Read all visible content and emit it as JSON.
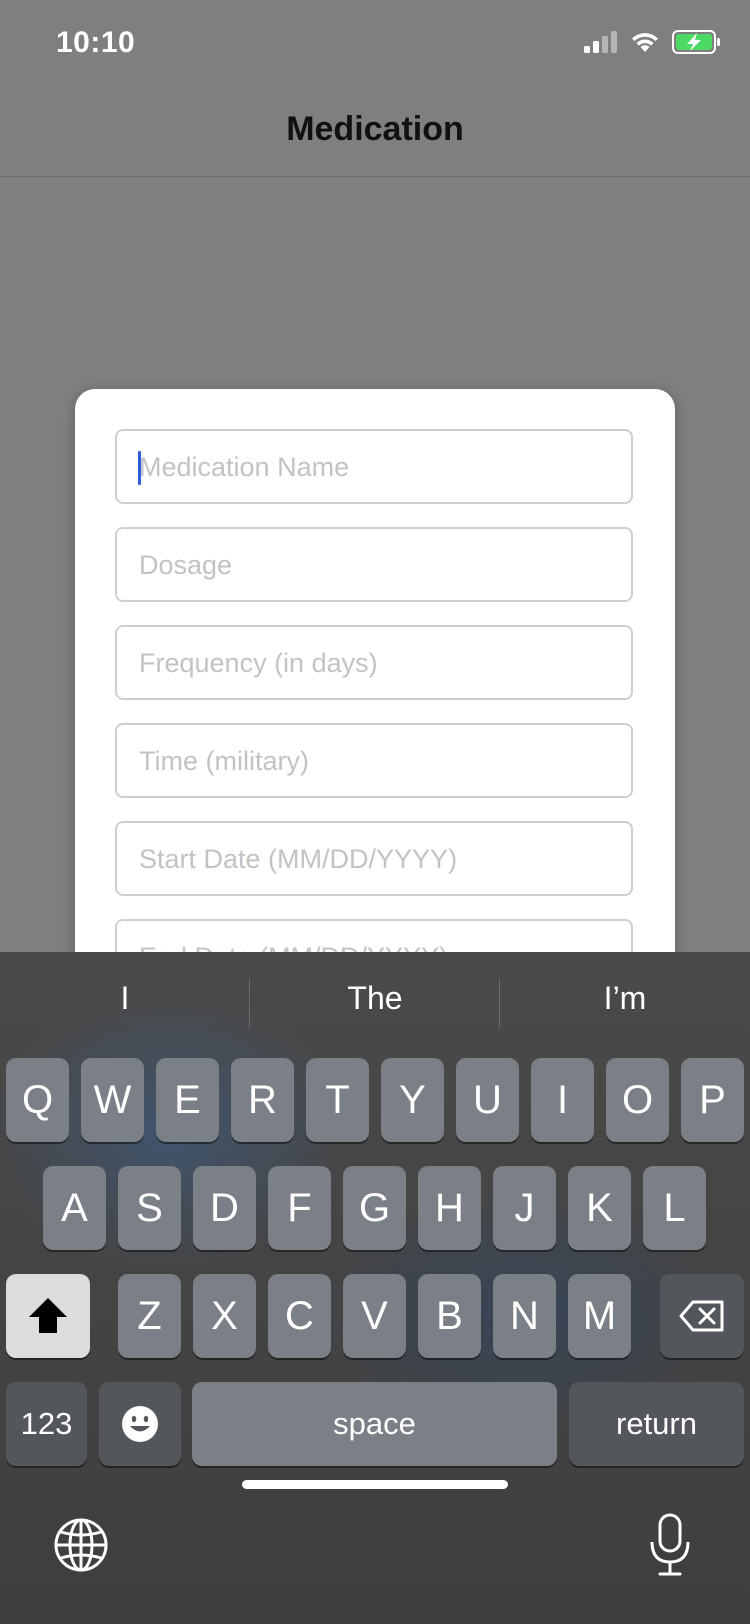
{
  "status_bar": {
    "time": "10:10"
  },
  "nav": {
    "title": "Medication"
  },
  "form": {
    "medication_name_placeholder": "Medication Name",
    "dosage_placeholder": "Dosage",
    "frequency_placeholder": "Frequency (in days)",
    "time_placeholder": "Time (military)",
    "start_date_placeholder": "Start Date (MM/DD/YYYY)",
    "end_date_placeholder": "End Date (MM/DD/YYYY)"
  },
  "keyboard": {
    "suggestions": [
      "I",
      "The",
      "I’m"
    ],
    "row1": [
      "Q",
      "W",
      "E",
      "R",
      "T",
      "Y",
      "U",
      "I",
      "O",
      "P"
    ],
    "row2": [
      "A",
      "S",
      "D",
      "F",
      "G",
      "H",
      "J",
      "K",
      "L"
    ],
    "row3": [
      "Z",
      "X",
      "C",
      "V",
      "B",
      "N",
      "M"
    ],
    "numbers_label": "123",
    "space_label": "space",
    "return_label": "return"
  },
  "colors": {
    "accent_caret": "#2d5bd9",
    "battery_green": "#4cd964"
  }
}
